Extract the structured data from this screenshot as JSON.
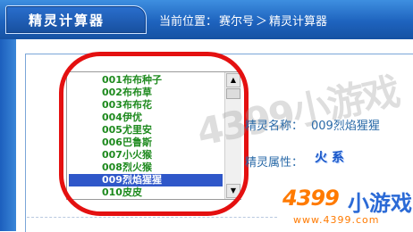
{
  "header": {
    "title": "精灵计算器",
    "breadcrumb_prefix": "当前位置：",
    "breadcrumb_site": "赛尔号",
    "breadcrumb_sep": "＞",
    "breadcrumb_page": "精灵计算器"
  },
  "list": {
    "items": [
      "001布布种子",
      "002布布草",
      "003布布花",
      "004伊优",
      "005尤里安",
      "006巴鲁斯",
      "007小火猴",
      "008烈火猴",
      "009烈焰猩猩",
      "010皮皮"
    ],
    "selected": "009烈焰猩猩"
  },
  "info": {
    "name_label": "精灵名称：",
    "name_value": "009烈焰猩猩",
    "attr_label": "精灵属性：",
    "attr_value": "火 系"
  },
  "watermark": {
    "text": "4399小游戏"
  },
  "logo": {
    "main": "4399",
    "sub": "小游戏",
    "url": "www.4399.com"
  },
  "colors": {
    "header_blue": "#1e63be",
    "list_green": "#1e8a1e",
    "selected_bg": "#2f57c9",
    "annotation_red": "#e41010",
    "logo_orange": "#ff7a00"
  }
}
